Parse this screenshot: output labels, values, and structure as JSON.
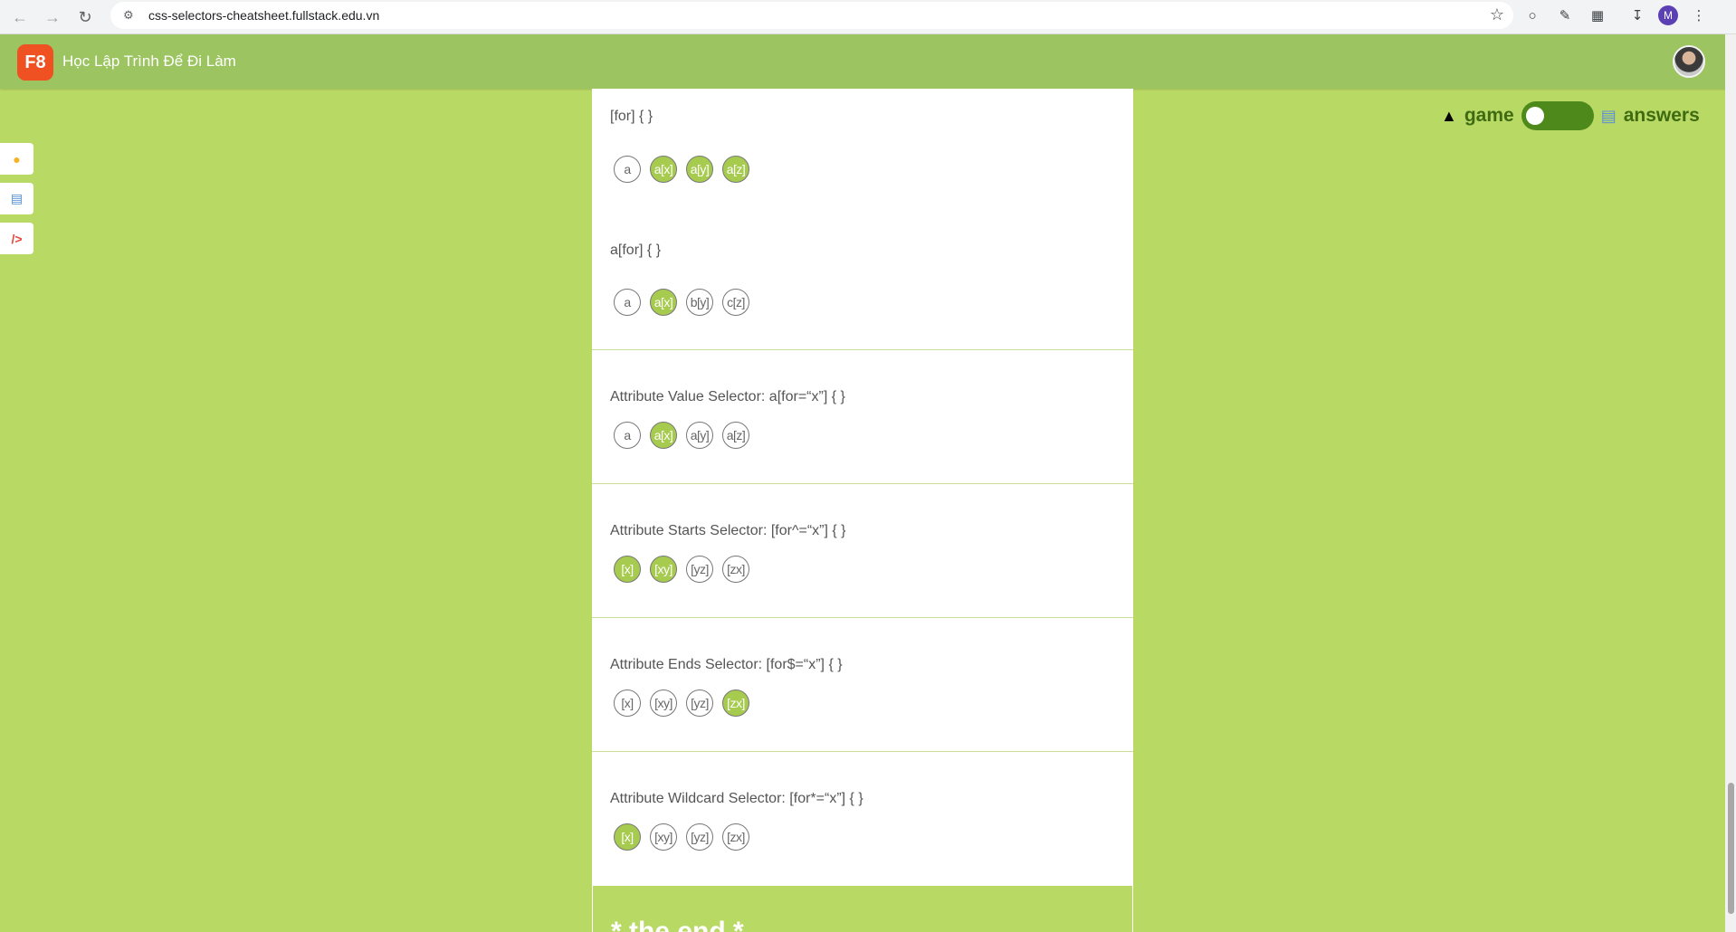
{
  "browser": {
    "url": "css-selectors-cheatsheet.fullstack.edu.vn",
    "profile_initial": "M",
    "icons": {
      "back": "arrow-left-icon",
      "forward": "arrow-right-icon",
      "reload": "reload-icon",
      "site_info": "site-info-icon",
      "bookmark": "star-icon",
      "downloads": "download-icon",
      "menu": "kebab-menu-icon"
    }
  },
  "app": {
    "logo_text": "F8",
    "brand": "Học Lập Trình Để Đi Làm"
  },
  "mode": {
    "left_label": "game",
    "right_label": "answers",
    "toggle_on": false
  },
  "sections": [
    {
      "title": "[for] { }",
      "chips": [
        {
          "label": "a",
          "selected": false
        },
        {
          "label": "a[x]",
          "selected": true
        },
        {
          "label": "a[y]",
          "selected": true
        },
        {
          "label": "a[z]",
          "selected": true
        }
      ]
    },
    {
      "title": "a[for] { }",
      "chips": [
        {
          "label": "a",
          "selected": false
        },
        {
          "label": "a[x]",
          "selected": true
        },
        {
          "label": "b[y]",
          "selected": false
        },
        {
          "label": "c[z]",
          "selected": false
        }
      ]
    },
    {
      "title": "Attribute Value Selector: a[for=“x”] { }",
      "chips": [
        {
          "label": "a",
          "selected": false
        },
        {
          "label": "a[x]",
          "selected": true
        },
        {
          "label": "a[y]",
          "selected": false
        },
        {
          "label": "a[z]",
          "selected": false
        }
      ]
    },
    {
      "title": "Attribute Starts Selector: [for^=“x”] { }",
      "chips": [
        {
          "label": "[x]",
          "selected": true
        },
        {
          "label": "[xy]",
          "selected": true
        },
        {
          "label": "[yz]",
          "selected": false
        },
        {
          "label": "[zx]",
          "selected": false
        }
      ]
    },
    {
      "title": "Attribute Ends Selector: [for$=“x”] { }",
      "chips": [
        {
          "label": "[x]",
          "selected": false
        },
        {
          "label": "[xy]",
          "selected": false
        },
        {
          "label": "[yz]",
          "selected": false
        },
        {
          "label": "[zx]",
          "selected": true
        }
      ]
    },
    {
      "title": "Attribute Wildcard Selector: [for*=“x”] { }",
      "chips": [
        {
          "label": "[x]",
          "selected": true
        },
        {
          "label": "[xy]",
          "selected": false
        },
        {
          "label": "[yz]",
          "selected": false
        },
        {
          "label": "[zx]",
          "selected": false
        }
      ]
    }
  ],
  "end_text": "* the end *"
}
